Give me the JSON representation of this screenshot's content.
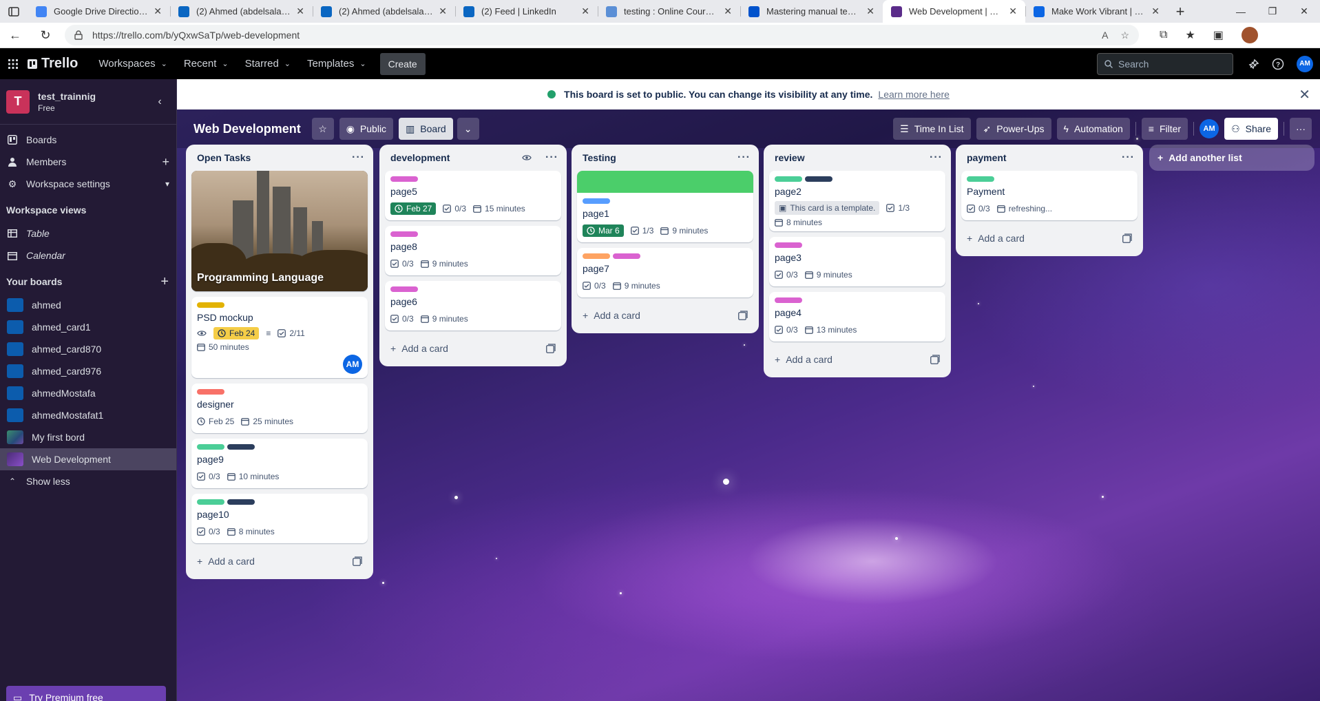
{
  "browser": {
    "tabs": [
      {
        "title": "Google Drive Directions - ...",
        "favicon_color": "#4285f4"
      },
      {
        "title": "(2) Ahmed (abdelsalame) M...",
        "favicon_color": "#0a66c2"
      },
      {
        "title": "(2) Ahmed (abdelsalame) M...",
        "favicon_color": "#0a66c2"
      },
      {
        "title": "(2) Feed | LinkedIn",
        "favicon_color": "#0a66c2"
      },
      {
        "title": "testing : Online Courses, Tr...",
        "favicon_color": "#5b8fd6"
      },
      {
        "title": "Mastering manual testing",
        "favicon_color": "#0052cc"
      },
      {
        "title": "Web Development | Trello",
        "favicon_color": "#5b2c8a",
        "active": true
      },
      {
        "title": "Make Work Vibrant | Trello",
        "favicon_color": "#0c66e4"
      }
    ],
    "url": "https://trello.com/b/yQxwSaTp/web-development"
  },
  "header": {
    "logo": "Trello",
    "menus": [
      "Workspaces",
      "Recent",
      "Starred",
      "Templates"
    ],
    "create_label": "Create",
    "search_placeholder": "Search",
    "avatar_initials": "AM"
  },
  "sidebar": {
    "workspace_initial": "T",
    "workspace_name": "test_trainnig",
    "plan": "Free",
    "items": [
      {
        "label": "Boards",
        "icon": "trello-icon"
      },
      {
        "label": "Members",
        "icon": "person-icon"
      },
      {
        "label": "Workspace settings",
        "icon": "gear-icon"
      }
    ],
    "views_title": "Workspace views",
    "views": [
      {
        "label": "Table",
        "icon": "table-icon"
      },
      {
        "label": "Calendar",
        "icon": "calendar-icon"
      }
    ],
    "boards_title": "Your boards",
    "boards": [
      {
        "label": "ahmed"
      },
      {
        "label": "ahmed_card1"
      },
      {
        "label": "ahmed_card870"
      },
      {
        "label": "ahmed_card976"
      },
      {
        "label": "ahmedMostafa"
      },
      {
        "label": "ahmedMostafat1"
      },
      {
        "label": "My first bord"
      },
      {
        "label": "Web Development",
        "selected": true
      }
    ],
    "show_less": "Show less",
    "premium": "Try Premium free"
  },
  "notice": {
    "text": "This board is set to public. You can change its visibility at any time.",
    "link": "Learn more here"
  },
  "board": {
    "title": "Web Development",
    "visibility": "Public",
    "view": "Board",
    "actions": [
      "Time In List",
      "Power-Ups",
      "Automation",
      "Filter"
    ],
    "share": "Share",
    "avatar_initials": "AM"
  },
  "lists": [
    {
      "title": "Open Tasks",
      "add_label": "Add a card",
      "cards": [
        {
          "image_caption": "Programming Language"
        },
        {
          "labels": [
            "#e2b203"
          ],
          "title": "PSD mockup",
          "watch": true,
          "due": "Feb 24",
          "due_style": "yellow",
          "description": true,
          "checklist": "2/11",
          "time": "50 minutes",
          "member": "AM"
        },
        {
          "labels": [
            "#f87168"
          ],
          "title": "designer",
          "due": "Feb 25",
          "due_style": "plain",
          "time": "25 minutes"
        },
        {
          "labels": [
            "#4bce97",
            "#2c3e5d"
          ],
          "title": "page9",
          "checklist": "0/3",
          "time": "10 minutes"
        },
        {
          "labels": [
            "#4bce97",
            "#2c3e5d"
          ],
          "title": "page10",
          "checklist": "0/3",
          "time": "8 minutes"
        }
      ]
    },
    {
      "title": "development",
      "watched": true,
      "add_label": "Add a card",
      "cards": [
        {
          "labels": [
            "#da62d0"
          ],
          "title": "page5",
          "due": "Feb 27",
          "due_style": "green",
          "checklist": "0/3",
          "time": "15 minutes"
        },
        {
          "labels": [
            "#da62d0"
          ],
          "title": "page8",
          "checklist": "0/3",
          "time": "9 minutes"
        },
        {
          "labels": [
            "#da62d0"
          ],
          "title": "page6",
          "checklist": "0/3",
          "time": "9 minutes"
        }
      ]
    },
    {
      "title": "Testing",
      "add_label": "Add a card",
      "cards": [
        {
          "cover": "#4bce6a",
          "labels": [
            "#579dff"
          ],
          "title": "page1",
          "due": "Mar 6",
          "due_style": "green",
          "checklist": "1/3",
          "time": "9 minutes"
        },
        {
          "labels": [
            "#fea362",
            "#da62d0"
          ],
          "title": "page7",
          "checklist": "0/3",
          "time": "9 minutes"
        }
      ]
    },
    {
      "title": "review",
      "add_label": "Add a card",
      "cards": [
        {
          "labels": [
            "#4bce97",
            "#2c3e5d"
          ],
          "title": "page2",
          "template": "This card is a template.",
          "checklist": "1/3",
          "time": "8 minutes"
        },
        {
          "labels": [
            "#da62d0"
          ],
          "title": "page3",
          "checklist": "0/3",
          "time": "9 minutes"
        },
        {
          "labels": [
            "#da62d0"
          ],
          "title": "page4",
          "checklist": "0/3",
          "time": "13 minutes"
        }
      ]
    },
    {
      "title": "payment",
      "add_label": "Add a card",
      "cards": [
        {
          "labels": [
            "#4bce97"
          ],
          "title": "Payment",
          "checklist": "0/3",
          "time": "refreshing..."
        }
      ]
    }
  ],
  "add_list_label": "Add another list"
}
